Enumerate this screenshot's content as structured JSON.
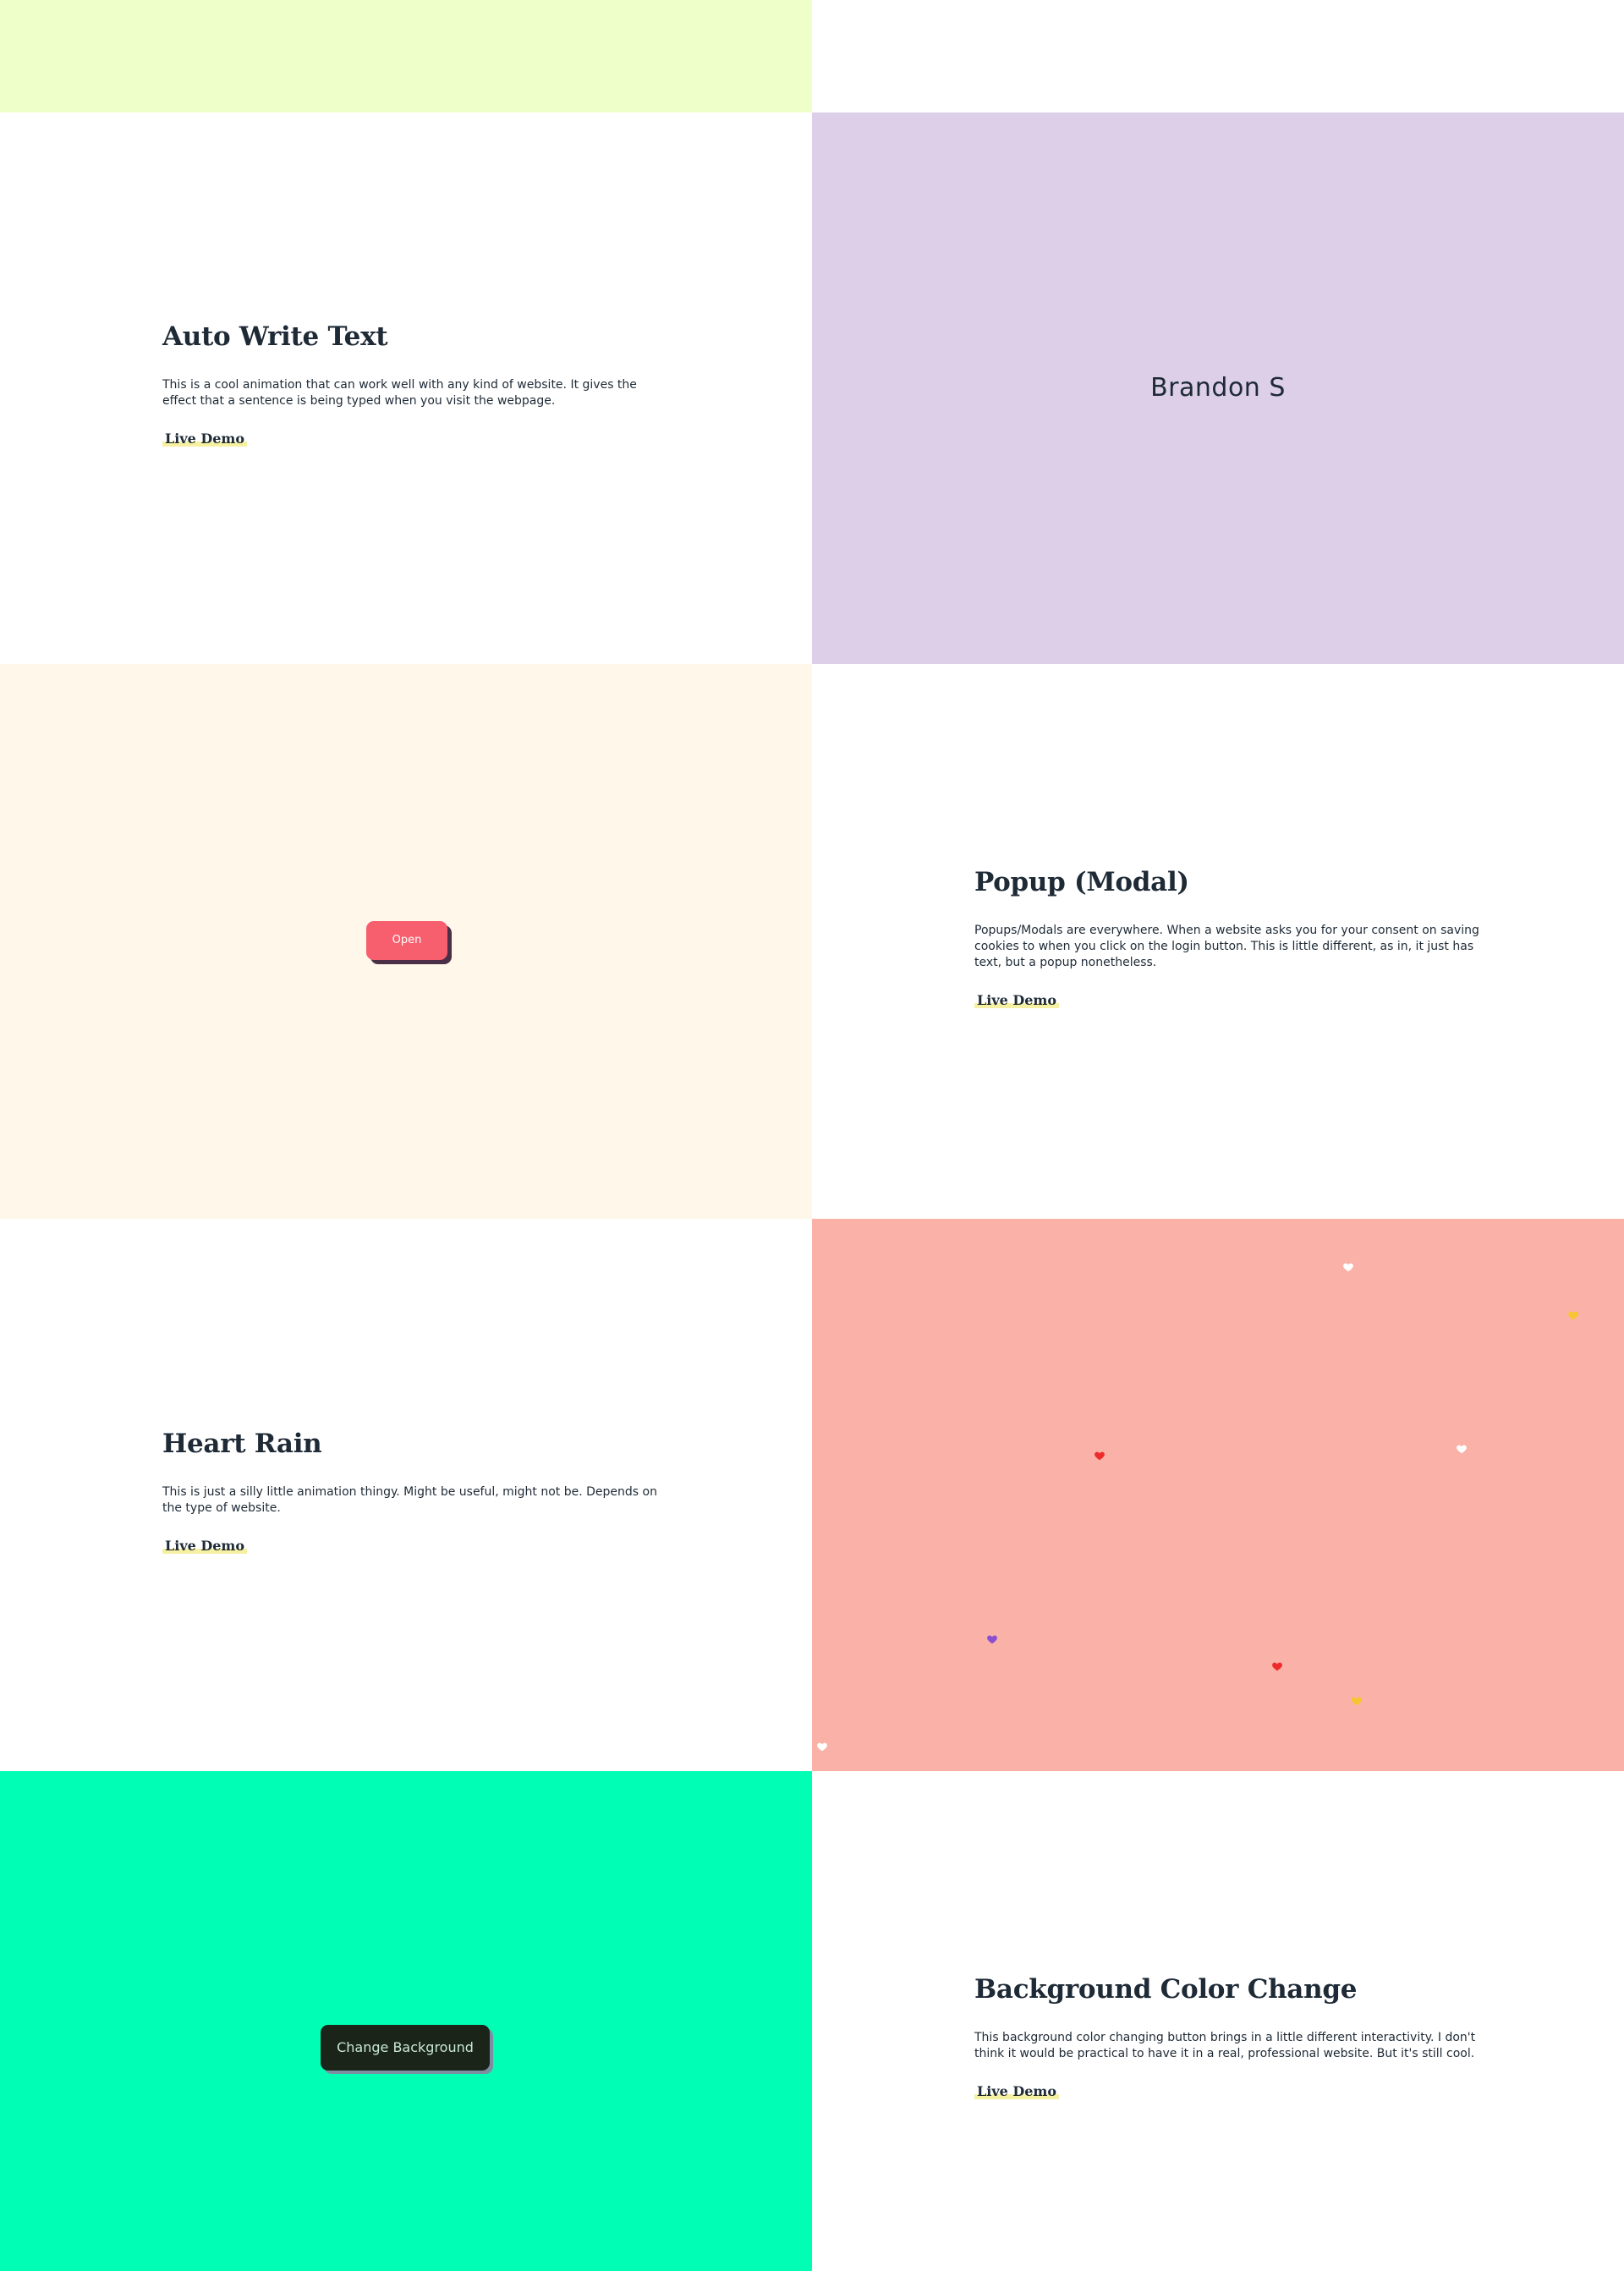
{
  "colors": {
    "top_strip": "#eeffca",
    "brandon_bg": "#dccfe7",
    "popup_demo_bg": "#fef7ea",
    "heart_bg": "#fab1a7",
    "bg_change_bg": "#00ffb4",
    "link_highlight": "#f6f0a2",
    "open_button": "#f75e6e",
    "change_bg_button": "#1b2418"
  },
  "sections": {
    "auto_write": {
      "title": "Auto Write Text",
      "description": "This is a cool animation that can work well with any kind of website. It gives the effect that a sentence is being typed when you visit the webpage.",
      "link": "Live Demo"
    },
    "auto_write_demo": {
      "text": "Brandon S"
    },
    "popup_demo": {
      "button": "Open"
    },
    "popup": {
      "title": "Popup (Modal)",
      "description": "Popups/Modals are everywhere. When a website asks you for your consent on saving cookies to when you click on the login button. This is little different, as in, it just has text, but a popup nonetheless.",
      "link": "Live Demo"
    },
    "heart_rain": {
      "title": "Heart Rain",
      "description": "This is just a silly little animation thingy. Might be useful, might not be. Depends on the type of website.",
      "link": "Live Demo"
    },
    "heart_rain_demo": {
      "hearts": [
        {
          "icon": "heart-icon",
          "color": "#ffffff"
        },
        {
          "icon": "heart-icon",
          "color": "#f7c531"
        },
        {
          "icon": "heart-icon",
          "color": "#ee2b2b"
        },
        {
          "icon": "heart-icon",
          "color": "#ffffff"
        },
        {
          "icon": "heart-icon",
          "color": "#8a4fd0"
        },
        {
          "icon": "heart-icon",
          "color": "#ee2b2b"
        },
        {
          "icon": "heart-icon",
          "color": "#f7c531"
        },
        {
          "icon": "heart-icon",
          "color": "#ffffff"
        }
      ]
    },
    "bg_change_demo": {
      "button": "Change Background"
    },
    "bg_change": {
      "title": "Background Color Change",
      "description": "This background color changing button brings in a little different interactivity. I don't think it would be practical to have it in a real, professional website. But it's still cool.",
      "link": "Live Demo"
    }
  }
}
